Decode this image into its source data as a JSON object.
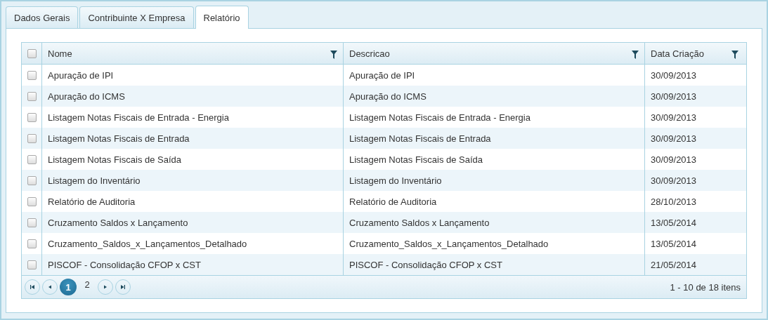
{
  "tabs": [
    {
      "label": "Dados Gerais",
      "selected": false
    },
    {
      "label": "Contribuinte X Empresa",
      "selected": false
    },
    {
      "label": "Relatório",
      "selected": true
    }
  ],
  "table": {
    "select_all": {
      "checked": false
    },
    "columns": [
      {
        "label": "Nome"
      },
      {
        "label": "Descricao"
      },
      {
        "label": "Data Criação"
      }
    ],
    "rows": [
      {
        "checked": false,
        "cells": [
          "Apuração de IPI",
          "Apuração de IPI",
          "30/09/2013"
        ]
      },
      {
        "checked": false,
        "cells": [
          "Apuração do ICMS",
          "Apuração do ICMS",
          "30/09/2013"
        ]
      },
      {
        "checked": false,
        "cells": [
          "Listagem Notas Fiscais de Entrada - Energia",
          "Listagem Notas Fiscais de Entrada - Energia",
          "30/09/2013"
        ]
      },
      {
        "checked": false,
        "cells": [
          "Listagem Notas Fiscais de Entrada",
          "Listagem Notas Fiscais de Entrada",
          "30/09/2013"
        ]
      },
      {
        "checked": false,
        "cells": [
          "Listagem Notas Fiscais de Saída",
          "Listagem Notas Fiscais de Saída",
          "30/09/2013"
        ]
      },
      {
        "checked": false,
        "cells": [
          "Listagem do Inventário",
          "Listagem do Inventário",
          "30/09/2013"
        ]
      },
      {
        "checked": false,
        "cells": [
          "Relatório de Auditoria",
          "Relatório de Auditoria",
          "28/10/2013"
        ]
      },
      {
        "checked": false,
        "cells": [
          "Cruzamento Saldos x Lançamento",
          "Cruzamento Saldos x Lançamento",
          "13/05/2014"
        ]
      },
      {
        "checked": false,
        "cells": [
          "Cruzamento_Saldos_x_Lançamentos_Detalhado",
          "Cruzamento_Saldos_x_Lançamentos_Detalhado",
          "13/05/2014"
        ]
      },
      {
        "checked": false,
        "cells": [
          "PISCOF - Consolidação CFOP x CST",
          "PISCOF - Consolidação CFOP x CST",
          "21/05/2014"
        ]
      }
    ]
  },
  "pager": {
    "pages": [
      {
        "label": "1",
        "selected": true
      },
      {
        "label": "2",
        "selected": false
      }
    ],
    "info": "1 - 10 de 18 itens"
  }
}
